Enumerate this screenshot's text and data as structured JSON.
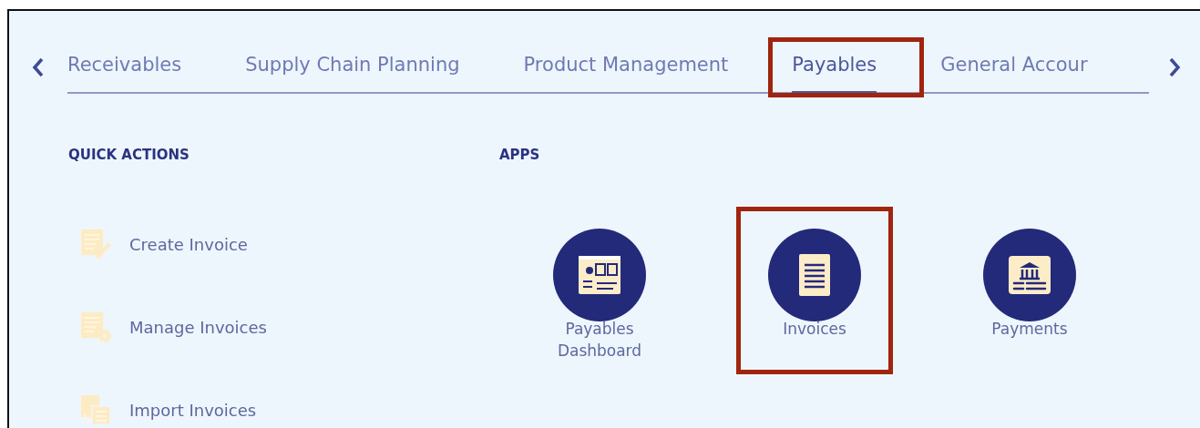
{
  "tabs": [
    {
      "label": "Receivables",
      "selected": false,
      "highlighted": false
    },
    {
      "label": "Supply Chain Planning",
      "selected": false,
      "highlighted": false
    },
    {
      "label": "Product Management",
      "selected": false,
      "highlighted": false
    },
    {
      "label": "Payables",
      "selected": true,
      "highlighted": true
    },
    {
      "label": "General Accour",
      "selected": false,
      "highlighted": false
    }
  ],
  "quick_actions": {
    "heading": "QUICK ACTIONS",
    "items": [
      {
        "kind": "create",
        "label": "Create Invoice"
      },
      {
        "kind": "manage",
        "label": "Manage Invoices"
      },
      {
        "kind": "import",
        "label": "Import Invoices"
      }
    ]
  },
  "apps": {
    "heading": "APPS",
    "items": [
      {
        "kind": "dashboard",
        "label": "Payables Dashboard",
        "highlighted": false
      },
      {
        "kind": "invoices",
        "label": "Invoices",
        "highlighted": true
      },
      {
        "kind": "payments",
        "label": "Payments",
        "highlighted": false
      }
    ]
  }
}
